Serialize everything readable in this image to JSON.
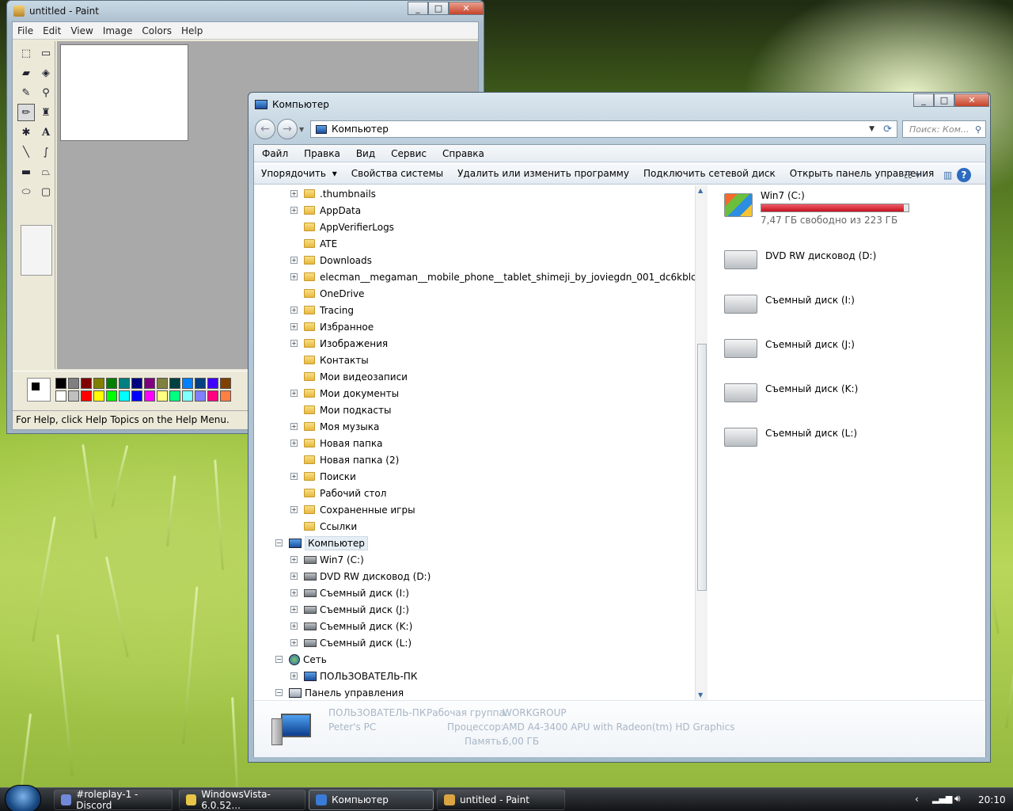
{
  "paint": {
    "title": "untitled - Paint",
    "menu": [
      "File",
      "Edit",
      "View",
      "Image",
      "Colors",
      "Help"
    ],
    "tools": [
      "free-form-select",
      "select",
      "eraser",
      "fill-with-color",
      "pick-color",
      "magnifier",
      "pencil",
      "brush",
      "airbrush",
      "text",
      "line",
      "curve",
      "rectangle",
      "polygon",
      "ellipse",
      "rounded-rectangle"
    ],
    "palette_top": [
      "#000000",
      "#808080",
      "#800000",
      "#808000",
      "#008000",
      "#008080",
      "#000080",
      "#800080",
      "#808040",
      "#004040",
      "#0080ff",
      "#004080",
      "#4000ff",
      "#804000"
    ],
    "palette_bottom": [
      "#ffffff",
      "#c0c0c0",
      "#ff0000",
      "#ffff00",
      "#00ff00",
      "#00ffff",
      "#0000ff",
      "#ff00ff",
      "#ffff80",
      "#00ff80",
      "#80ffff",
      "#8080ff",
      "#ff0080",
      "#ff8040"
    ],
    "status": "For Help, click Help Topics on the Help Menu."
  },
  "explorer": {
    "title": "Компьютер",
    "address": "Компьютер",
    "search_placeholder": "Поиск: Ком...",
    "menu": [
      "Файл",
      "Правка",
      "Вид",
      "Сервис",
      "Справка"
    ],
    "commands": [
      "Упорядочить",
      "Свойства системы",
      "Удалить или изменить программу",
      "Подключить сетевой диск",
      "Открыть панель управления"
    ],
    "tree": [
      {
        "label": ".thumbnails",
        "lvl": 2,
        "exp": true,
        "icon": "folder"
      },
      {
        "label": "AppData",
        "lvl": 2,
        "exp": true,
        "icon": "folder"
      },
      {
        "label": "AppVerifierLogs",
        "lvl": 2,
        "exp": false,
        "icon": "folder"
      },
      {
        "label": "ATE",
        "lvl": 2,
        "exp": false,
        "icon": "folder"
      },
      {
        "label": "Downloads",
        "lvl": 2,
        "exp": true,
        "icon": "folder"
      },
      {
        "label": "elecman__megaman__mobile_phone__tablet_shimeji_by_joviegdn_001_dc6kblc",
        "lvl": 2,
        "exp": true,
        "icon": "folder"
      },
      {
        "label": "OneDrive",
        "lvl": 2,
        "exp": false,
        "icon": "folder"
      },
      {
        "label": "Tracing",
        "lvl": 2,
        "exp": true,
        "icon": "folder"
      },
      {
        "label": "Избранное",
        "lvl": 2,
        "exp": true,
        "icon": "folder"
      },
      {
        "label": "Изображения",
        "lvl": 2,
        "exp": true,
        "icon": "folder"
      },
      {
        "label": "Контакты",
        "lvl": 2,
        "exp": false,
        "icon": "folder"
      },
      {
        "label": "Мои видеозаписи",
        "lvl": 2,
        "exp": false,
        "icon": "folder"
      },
      {
        "label": "Мои документы",
        "lvl": 2,
        "exp": true,
        "icon": "folder"
      },
      {
        "label": "Мои подкасты",
        "lvl": 2,
        "exp": false,
        "icon": "folder"
      },
      {
        "label": "Моя музыка",
        "lvl": 2,
        "exp": true,
        "icon": "folder"
      },
      {
        "label": "Новая папка",
        "lvl": 2,
        "exp": true,
        "icon": "folder"
      },
      {
        "label": "Новая папка (2)",
        "lvl": 2,
        "exp": false,
        "icon": "folder"
      },
      {
        "label": "Поиски",
        "lvl": 2,
        "exp": true,
        "icon": "folder"
      },
      {
        "label": "Рабочий стол",
        "lvl": 2,
        "exp": false,
        "icon": "folder"
      },
      {
        "label": "Сохраненные игры",
        "lvl": 2,
        "exp": true,
        "icon": "folder"
      },
      {
        "label": "Ссылки",
        "lvl": 2,
        "exp": false,
        "icon": "folder"
      },
      {
        "label": "Компьютер",
        "lvl": 1,
        "exp": "open",
        "icon": "computer",
        "selected": true
      },
      {
        "label": "Win7 (C:)",
        "lvl": 2,
        "exp": true,
        "icon": "drive"
      },
      {
        "label": "DVD RW дисковод (D:)",
        "lvl": 2,
        "exp": true,
        "icon": "drive"
      },
      {
        "label": "Съемный диск (I:)",
        "lvl": 2,
        "exp": true,
        "icon": "drive"
      },
      {
        "label": "Съемный диск (J:)",
        "lvl": 2,
        "exp": true,
        "icon": "drive"
      },
      {
        "label": "Съемный диск (K:)",
        "lvl": 2,
        "exp": true,
        "icon": "drive"
      },
      {
        "label": "Съемный диск (L:)",
        "lvl": 2,
        "exp": true,
        "icon": "drive"
      },
      {
        "label": "Сеть",
        "lvl": 1,
        "exp": "open",
        "icon": "network"
      },
      {
        "label": "ПОЛЬЗОВАТЕЛЬ-ПК",
        "lvl": 2,
        "exp": true,
        "icon": "computer"
      },
      {
        "label": "Панель управления",
        "lvl": 1,
        "exp": "open",
        "icon": "panel"
      }
    ],
    "drives": [
      {
        "name": "Win7 (C:)",
        "free": "7,47 ГБ свободно из 223 ГБ",
        "used_fraction": 0.966
      },
      {
        "name": "DVD RW дисковод (D:)"
      },
      {
        "name": "Съемный диск (I:)"
      },
      {
        "name": "Съемный диск (J:)"
      },
      {
        "name": "Съемный диск (K:)"
      },
      {
        "name": "Съемный диск (L:)"
      }
    ],
    "details": {
      "pc_name": "ПОЛЬЗОВАТЕЛЬ-ПК",
      "pc_desc": "Peter's PC",
      "workgroup_label": "Рабочая группа:",
      "workgroup": "WORKGROUP",
      "cpu_label": "Процессор:",
      "cpu": "AMD A4-3400 APU with Radeon(tm) HD Graphics",
      "mem_label": "Память:",
      "mem": "6,00 ГБ"
    }
  },
  "taskbar": {
    "items": [
      {
        "label": "#roleplay-1 - Discord",
        "color": "#7289da"
      },
      {
        "label": "WindowsVista-6.0.52...",
        "color": "#e8c547"
      },
      {
        "label": "Компьютер",
        "color": "#3a7bd5"
      },
      {
        "label": "untitled - Paint",
        "color": "#d9a441"
      }
    ],
    "clock": "20:10"
  }
}
